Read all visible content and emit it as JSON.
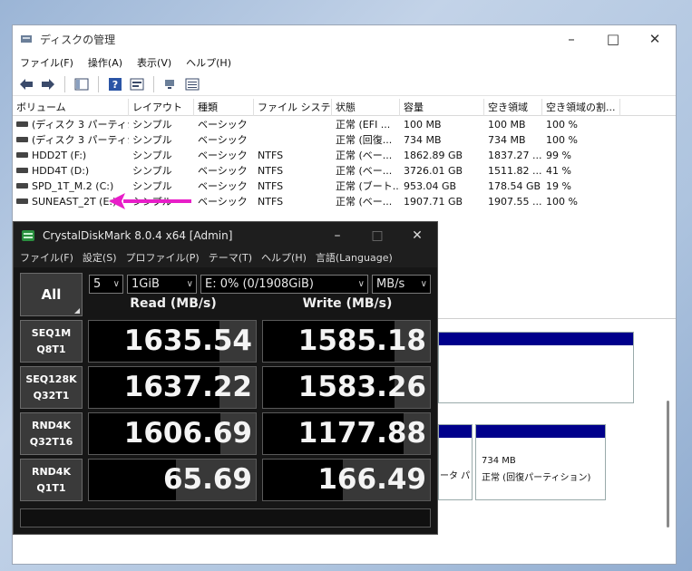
{
  "dm": {
    "title": "ディスクの管理",
    "menu": [
      "ファイル(F)",
      "操作(A)",
      "表示(V)",
      "ヘルプ(H)"
    ],
    "columns": [
      "ボリューム",
      "レイアウト",
      "種類",
      "ファイル システム",
      "状態",
      "容量",
      "空き領域",
      "空き領域の割..."
    ],
    "rows": [
      [
        "(ディスク 3 パーティシ...",
        "シンプル",
        "ベーシック",
        "",
        "正常 (EFI ...",
        "100 MB",
        "100 MB",
        "100 %"
      ],
      [
        "(ディスク 3 パーティシ...",
        "シンプル",
        "ベーシック",
        "",
        "正常 (回復...",
        "734 MB",
        "734 MB",
        "100 %"
      ],
      [
        "HDD2T (F:)",
        "シンプル",
        "ベーシック",
        "NTFS",
        "正常 (ベー...",
        "1862.89 GB",
        "1837.27 ...",
        "99 %"
      ],
      [
        "HDD4T (D:)",
        "シンプル",
        "ベーシック",
        "NTFS",
        "正常 (ベー...",
        "3726.01 GB",
        "1511.82 ...",
        "41 %"
      ],
      [
        "SPD_1T_M.2 (C:)",
        "シンプル",
        "ベーシック",
        "NTFS",
        "正常 (ブート...",
        "953.04 GB",
        "178.54 GB",
        "19 %"
      ],
      [
        "SUNEAST_2T (E:)",
        "シンプル",
        "ベーシック",
        "NTFS",
        "正常 (ベー...",
        "1907.71 GB",
        "1907.55 ...",
        "100 %"
      ]
    ],
    "partition_size": "734 MB",
    "partition_status": "正常 (回復パーティション)",
    "partition_left_text": "ータ パ"
  },
  "cdm": {
    "title": "CrystalDiskMark 8.0.4 x64 [Admin]",
    "menu": [
      "ファイル(F)",
      "設定(S)",
      "プロファイル(P)",
      "テーマ(T)",
      "ヘルプ(H)",
      "言語(Language)"
    ],
    "count": "5",
    "size": "1GiB",
    "drive": "E: 0% (0/1908GiB)",
    "unit": "MB/s",
    "all_label": "All",
    "read_header": "Read (MB/s)",
    "write_header": "Write (MB/s)",
    "tests": [
      {
        "l1": "SEQ1M",
        "l2": "Q8T1",
        "read": "1635.54",
        "write": "1585.18",
        "read_ratio": 0.22,
        "write_ratio": 0.21
      },
      {
        "l1": "SEQ128K",
        "l2": "Q32T1",
        "read": "1637.22",
        "write": "1583.26",
        "read_ratio": 0.22,
        "write_ratio": 0.21
      },
      {
        "l1": "RND4K",
        "l2": "Q32T16",
        "read": "1606.69",
        "write": "1177.88",
        "read_ratio": 0.21,
        "write_ratio": 0.16
      },
      {
        "l1": "RND4K",
        "l2": "Q1T1",
        "read": "65.69",
        "write": "166.49",
        "read_ratio": 0.48,
        "write_ratio": 0.52
      }
    ]
  },
  "colors": {
    "arrow": "#e81ec8",
    "cdm_bg": "#1e1e1e",
    "disk_bar": "#00008b"
  }
}
